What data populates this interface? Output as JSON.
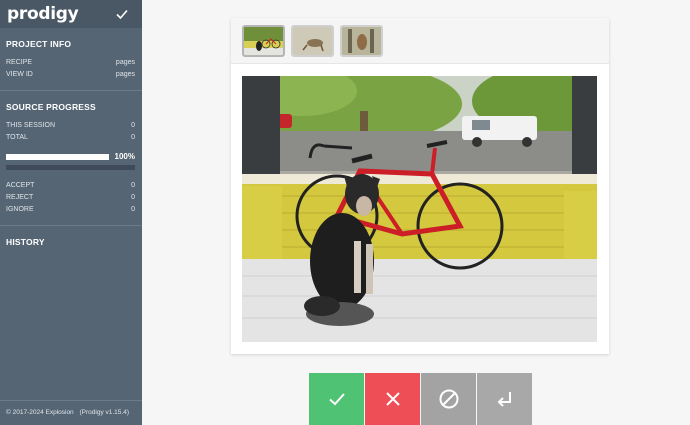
{
  "app": {
    "logo": "prodigy"
  },
  "sidebar": {
    "project": {
      "title": "PROJECT INFO",
      "rows": [
        {
          "label": "RECIPE",
          "value": "pages"
        },
        {
          "label": "VIEW ID",
          "value": "pages"
        }
      ]
    },
    "progress": {
      "title": "SOURCE PROGRESS",
      "session_label": "THIS SESSION",
      "session_value": "0",
      "total_label": "TOTAL",
      "total_value": "0",
      "percent_text": "100%",
      "percent": 100,
      "accept_label": "ACCEPT",
      "accept_value": "0",
      "reject_label": "REJECT",
      "reject_value": "0",
      "ignore_label": "IGNORE",
      "ignore_value": "0"
    },
    "history": {
      "title": "HISTORY"
    },
    "footer": {
      "copyright": "© 2017-2024 Explosion",
      "version": "(Prodigy v1.15.4)"
    }
  },
  "icons": {
    "top_check": "check-icon",
    "accept": "check-icon",
    "reject": "x-icon",
    "ignore": "no-entry-icon",
    "undo": "undo-arrow-icon"
  },
  "colors": {
    "sidebar": "#566574",
    "accept": "#4fc274",
    "reject": "#ee4e55",
    "ignore": "#a3a3a3"
  }
}
